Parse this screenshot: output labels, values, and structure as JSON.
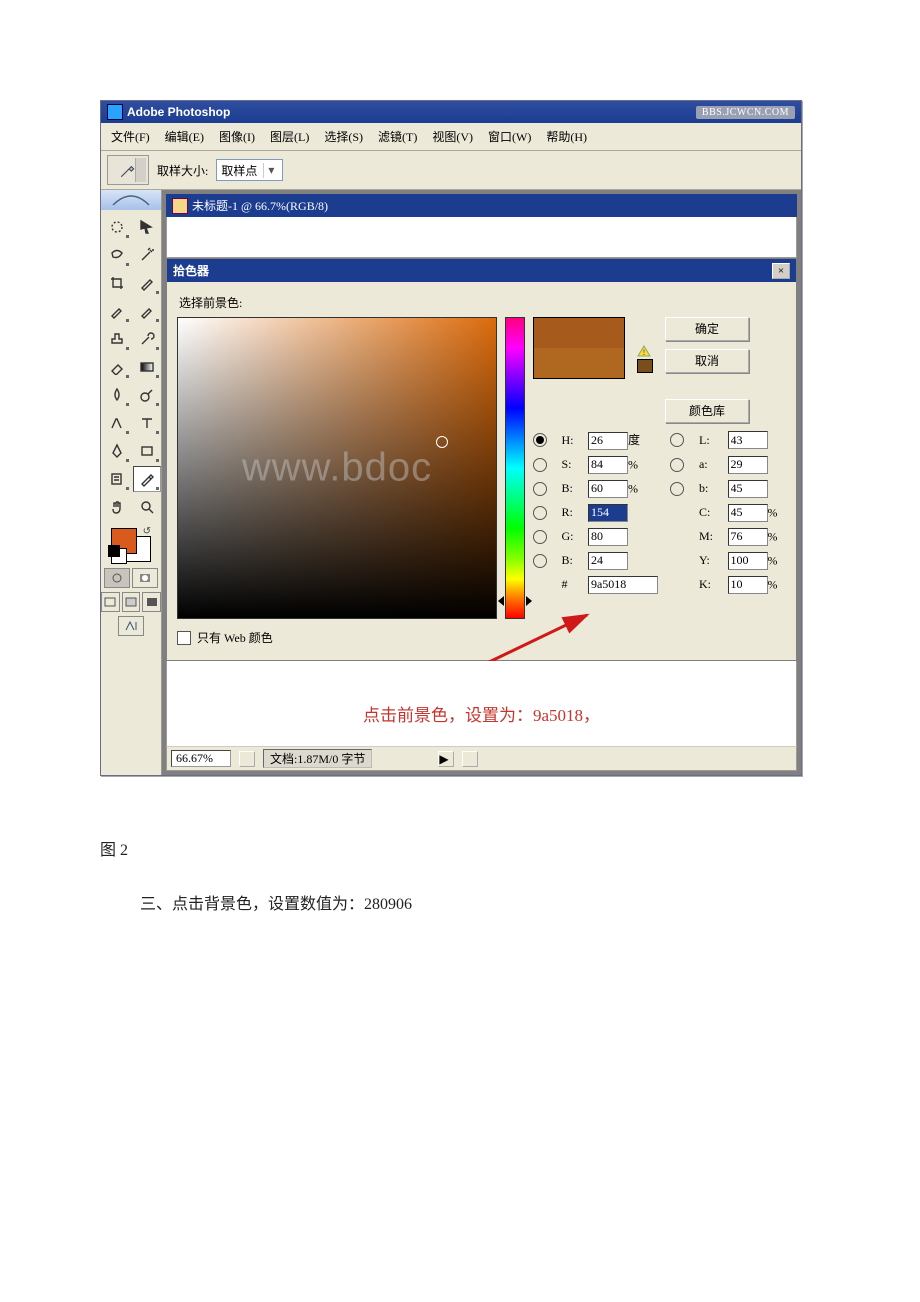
{
  "app": {
    "title": "Adobe Photoshop",
    "watermark_badge": "BBS.JCWCN.COM",
    "center_watermark": "www.bdoc"
  },
  "menu": {
    "file": "文件(F)",
    "edit": "编辑(E)",
    "image": "图像(I)",
    "layer": "图层(L)",
    "select": "选择(S)",
    "filter": "滤镜(T)",
    "view": "视图(V)",
    "window": "窗口(W)",
    "help": "帮助(H)"
  },
  "option_bar": {
    "sample_size_label": "取样大小:",
    "sample_size_value": "取样点"
  },
  "document": {
    "title": "未标题-1 @ 66.7%(RGB/8)"
  },
  "picker": {
    "window_title": "拾色器",
    "prompt": "选择前景色:",
    "ok": "确定",
    "cancel": "取消",
    "library": "颜色库",
    "H": {
      "label": "H:",
      "value": "26",
      "unit": "度"
    },
    "S": {
      "label": "S:",
      "value": "84",
      "unit": "%"
    },
    "Bv": {
      "label": "B:",
      "value": "60",
      "unit": "%"
    },
    "R": {
      "label": "R:",
      "value": "154"
    },
    "G": {
      "label": "G:",
      "value": "80"
    },
    "B": {
      "label": "B:",
      "value": "24"
    },
    "L": {
      "label": "L:",
      "value": "43"
    },
    "a": {
      "label": "a:",
      "value": "29"
    },
    "b": {
      "label": "b:",
      "value": "45"
    },
    "C": {
      "label": "C:",
      "value": "45",
      "unit": "%"
    },
    "M": {
      "label": "M:",
      "value": "76",
      "unit": "%"
    },
    "Y": {
      "label": "Y:",
      "value": "100",
      "unit": "%"
    },
    "K": {
      "label": "K:",
      "value": "10",
      "unit": "%"
    },
    "hex_prefix": "#",
    "hex": "9a5018",
    "web_only": "只有 Web 颜色"
  },
  "annotation": {
    "caption": "点击前景色，设置为：9a5018，"
  },
  "status": {
    "zoom": "66.67%",
    "doc": "文档:1.87M/0 字节"
  },
  "below": {
    "figure_label": "图 2",
    "step": "三、点击背景色，设置数值为：280906"
  }
}
